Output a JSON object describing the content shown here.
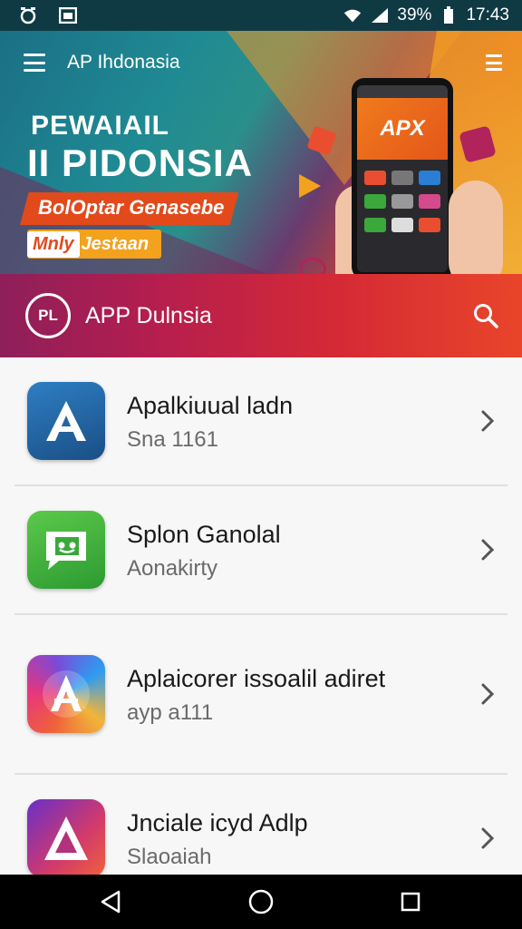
{
  "status_bar": {
    "battery_percent": "39%",
    "time": "17:43"
  },
  "header": {
    "app_title": "AP Ihdonasia"
  },
  "banner": {
    "headline_line1": "PEWAIAIL",
    "headline_line2": "II PIDONSIA",
    "tagline": "BolOptar Genasebe",
    "tag_box": "Mnly",
    "tag_rest": "Jestaan",
    "phone_logo": "APX"
  },
  "app_bar": {
    "logo_text": "PL",
    "title": "APP Dulnsia"
  },
  "apps": [
    {
      "title": "Apalkiuual ladn",
      "subtitle": "Sna 1161",
      "icon": "letter-a-icon",
      "color": "#1d5a93"
    },
    {
      "title": "Splon Ganolal",
      "subtitle": "Aonakirty",
      "icon": "chat-icon",
      "color": "#3aa83a"
    },
    {
      "title": "Aplaicorer issoalil adiret",
      "subtitle": "ayp a111",
      "icon": "app-store-icon",
      "color": "#7b4ad8"
    },
    {
      "title": "Jnciale icyd Adlp",
      "subtitle": "Slaoaiah",
      "icon": "triangle-icon",
      "color": "#7a2fb0"
    }
  ],
  "colors": {
    "accent": "#d52a35",
    "status_bar": "#0f3a44"
  }
}
